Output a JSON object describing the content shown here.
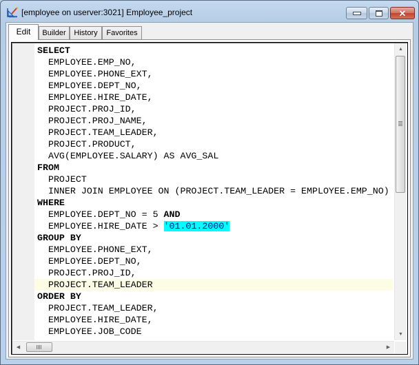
{
  "window": {
    "title": "[employee on userver:3021] Employee_project",
    "controls": {
      "minimize": "minimize",
      "maximize": "maximize",
      "close": "close"
    }
  },
  "tabs": [
    {
      "label": "Edit",
      "active": true
    },
    {
      "label": "Builder",
      "active": false
    },
    {
      "label": "History",
      "active": false
    },
    {
      "label": "Favorites",
      "active": false
    }
  ],
  "editor": {
    "current_line_index": 20,
    "lines": [
      {
        "indent": 0,
        "segments": [
          {
            "text": "SELECT",
            "type": "keyword"
          }
        ]
      },
      {
        "indent": 2,
        "segments": [
          {
            "text": "EMPLOYEE.EMP_NO,",
            "type": "plain"
          }
        ]
      },
      {
        "indent": 2,
        "segments": [
          {
            "text": "EMPLOYEE.PHONE_EXT,",
            "type": "plain"
          }
        ]
      },
      {
        "indent": 2,
        "segments": [
          {
            "text": "EMPLOYEE.DEPT_NO,",
            "type": "plain"
          }
        ]
      },
      {
        "indent": 2,
        "segments": [
          {
            "text": "EMPLOYEE.HIRE_DATE,",
            "type": "plain"
          }
        ]
      },
      {
        "indent": 2,
        "segments": [
          {
            "text": "PROJECT.PROJ_ID,",
            "type": "plain"
          }
        ]
      },
      {
        "indent": 2,
        "segments": [
          {
            "text": "PROJECT.PROJ_NAME,",
            "type": "plain"
          }
        ]
      },
      {
        "indent": 2,
        "segments": [
          {
            "text": "PROJECT.TEAM_LEADER,",
            "type": "plain"
          }
        ]
      },
      {
        "indent": 2,
        "segments": [
          {
            "text": "PROJECT.PRODUCT,",
            "type": "plain"
          }
        ]
      },
      {
        "indent": 2,
        "segments": [
          {
            "text": "AVG(EMPLOYEE.SALARY) AS AVG_SAL",
            "type": "plain"
          }
        ]
      },
      {
        "indent": 0,
        "segments": [
          {
            "text": "FROM",
            "type": "keyword"
          }
        ]
      },
      {
        "indent": 2,
        "segments": [
          {
            "text": "PROJECT",
            "type": "plain"
          }
        ]
      },
      {
        "indent": 2,
        "segments": [
          {
            "text": "INNER JOIN EMPLOYEE ON (PROJECT.TEAM_LEADER = EMPLOYEE.EMP_NO)",
            "type": "plain"
          }
        ]
      },
      {
        "indent": 0,
        "segments": [
          {
            "text": "WHERE",
            "type": "keyword"
          }
        ]
      },
      {
        "indent": 2,
        "segments": [
          {
            "text": "EMPLOYEE.DEPT_NO = 5 ",
            "type": "plain"
          },
          {
            "text": "AND",
            "type": "keyword"
          }
        ]
      },
      {
        "indent": 2,
        "segments": [
          {
            "text": "EMPLOYEE.HIRE_DATE > ",
            "type": "plain"
          },
          {
            "text": "'01.01.2000'",
            "type": "string"
          }
        ]
      },
      {
        "indent": 0,
        "segments": [
          {
            "text": "GROUP BY",
            "type": "keyword"
          }
        ]
      },
      {
        "indent": 2,
        "segments": [
          {
            "text": "EMPLOYEE.PHONE_EXT,",
            "type": "plain"
          }
        ]
      },
      {
        "indent": 2,
        "segments": [
          {
            "text": "EMPLOYEE.DEPT_NO,",
            "type": "plain"
          }
        ]
      },
      {
        "indent": 2,
        "segments": [
          {
            "text": "PROJECT.PROJ_ID,",
            "type": "plain"
          }
        ]
      },
      {
        "indent": 2,
        "segments": [
          {
            "text": "PROJECT.TEAM_LEADER",
            "type": "plain"
          }
        ]
      },
      {
        "indent": 0,
        "segments": [
          {
            "text": "ORDER BY",
            "type": "keyword"
          }
        ]
      },
      {
        "indent": 2,
        "segments": [
          {
            "text": "PROJECT.TEAM_LEADER,",
            "type": "plain"
          }
        ]
      },
      {
        "indent": 2,
        "segments": [
          {
            "text": "EMPLOYEE.HIRE_DATE,",
            "type": "plain"
          }
        ]
      },
      {
        "indent": 2,
        "segments": [
          {
            "text": "EMPLOYEE.JOB_CODE",
            "type": "plain"
          }
        ]
      }
    ]
  },
  "icons": {
    "app": "query-editor-icon",
    "scroll_up": "▲",
    "scroll_down": "▼",
    "scroll_left": "◀",
    "scroll_right": "▶"
  }
}
